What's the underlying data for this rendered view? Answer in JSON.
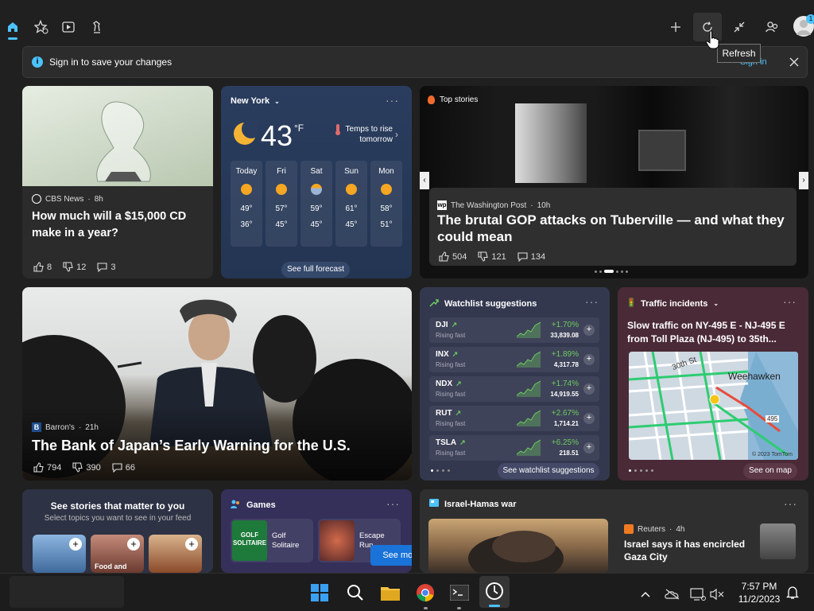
{
  "topbar": {
    "tabs": [
      {
        "icon": "home-icon",
        "active": true
      },
      {
        "icon": "star-icon"
      },
      {
        "icon": "play-icon"
      },
      {
        "icon": "chess-icon"
      }
    ],
    "actions": [
      "add-icon",
      "refresh-icon",
      "collapse-icon",
      "people-icon",
      "avatar"
    ],
    "tooltip": "Refresh",
    "avatar_badge": "1"
  },
  "banner": {
    "text": "Sign in to save your changes",
    "link": "Sign in"
  },
  "cd_card": {
    "source": "CBS News",
    "time": "8h",
    "title": "How much will a $15,000 CD make in a year?",
    "likes": "8",
    "dislikes": "12",
    "comments": "3"
  },
  "weather": {
    "location": "New York",
    "temp": "43",
    "unit": "°F",
    "note": "Temps to rise tomorrow",
    "days": [
      {
        "day": "Today",
        "high": "49°",
        "low": "36°"
      },
      {
        "day": "Fri",
        "high": "57°",
        "low": "45°"
      },
      {
        "day": "Sat",
        "high": "59°",
        "low": "45°"
      },
      {
        "day": "Sun",
        "high": "61°",
        "low": "45°"
      },
      {
        "day": "Mon",
        "high": "58°",
        "low": "51°"
      }
    ],
    "forecast_button": "See full forecast"
  },
  "top_stories": {
    "label": "Top stories",
    "source": "The Washington Post",
    "time": "10h",
    "title": "The brutal GOP attacks on Tuberville — and what they could mean",
    "likes": "504",
    "dislikes": "121",
    "comments": "134"
  },
  "boj_card": {
    "source": "Barron's",
    "time": "21h",
    "title": "The Bank of Japan’s Early Warning for the U.S.",
    "likes": "794",
    "dislikes": "390",
    "comments": "66"
  },
  "watchlist": {
    "title": "Watchlist suggestions",
    "stocks": [
      {
        "symbol": "DJI",
        "status": "Rising fast",
        "change": "+1.70%",
        "price": "33,839.08"
      },
      {
        "symbol": "INX",
        "status": "Rising fast",
        "change": "+1.89%",
        "price": "4,317.78"
      },
      {
        "symbol": "NDX",
        "status": "Rising fast",
        "change": "+1.74%",
        "price": "14,919.55"
      },
      {
        "symbol": "RUT",
        "status": "Rising fast",
        "change": "+2.67%",
        "price": "1,714.21"
      },
      {
        "symbol": "TSLA",
        "status": "Rising fast",
        "change": "+6.25%",
        "price": "218.51"
      }
    ],
    "button": "See watchlist suggestions"
  },
  "traffic": {
    "title": "Traffic incidents",
    "headline": "Slow traffic on NY-495 E - NJ-495 E from Toll Plaza (NJ-495) to 35th...",
    "map_labels": {
      "street": "30th St",
      "city": "Weehawken",
      "road": "495",
      "copyright": "© 2023 TomTom"
    },
    "button": "See on map"
  },
  "topics": {
    "title": "See stories that matter to you",
    "subtitle": "Select topics you want to see in your feed",
    "tile_label": "Food and"
  },
  "games": {
    "title": "Games",
    "items": [
      {
        "name": "Golf Solitaire",
        "thumb": "GOLF SOLITAIRE"
      },
      {
        "name": "Escape Run"
      }
    ],
    "see_more": "See more"
  },
  "war": {
    "title": "Israel-Hamas war",
    "source": "Reuters",
    "time": "4h",
    "headline": "Israel says it has encircled Gaza City"
  },
  "taskbar": {
    "time": "7:57 PM",
    "date": "11/2/2023"
  },
  "colors": {
    "accent": "#4cc2ff",
    "positive": "#6ccb5f",
    "weather_bg": "#2a3d5e",
    "watchlist_bg": "#33384f",
    "traffic_bg": "#4a2a36",
    "games_bg": "#34305a"
  }
}
